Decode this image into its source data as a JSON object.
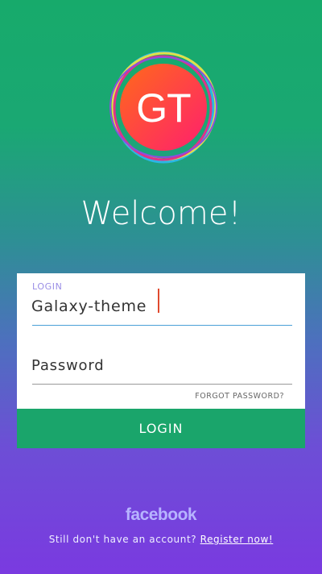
{
  "logo": {
    "text": "GT"
  },
  "heading": "Welcome!",
  "form": {
    "login_label": "LOGIN",
    "login_value": "Galaxy-theme",
    "password_placeholder": "Password",
    "forgot_label": "FORGOT PASSWORD?"
  },
  "login_button": "LOGIN",
  "facebook_label": "facebook",
  "footer": {
    "prompt": "Still don't have an account?",
    "register_link": "Register now!"
  },
  "colors": {
    "gradient_top": "#17aa6b",
    "gradient_bottom": "#7a3ae0",
    "button": "#1aa56b",
    "logo_fill_start": "#ff5a1a",
    "logo_fill_end": "#ff2a6a"
  }
}
